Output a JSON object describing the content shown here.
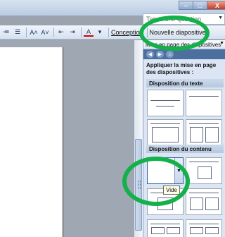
{
  "window": {
    "min": "–",
    "max": "□",
    "close": "X"
  },
  "help": {
    "placeholder": "Tapez une question"
  },
  "toolbar": {
    "items": [
      {
        "name": "bullets-icon",
        "glyph": "≔"
      },
      {
        "name": "numbering-icon",
        "glyph": "☰"
      },
      {
        "name": "font-grow-icon",
        "glyph": "A˄"
      },
      {
        "name": "font-shrink-icon",
        "glyph": "A˅"
      },
      {
        "name": "indent-less-icon",
        "glyph": "⇤"
      },
      {
        "name": "indent-more-icon",
        "glyph": "⇥"
      },
      {
        "name": "font-color-icon",
        "glyph": "A"
      },
      {
        "name": "dropdown-icon",
        "glyph": "▾"
      }
    ],
    "conception": "Conception",
    "nouvelle": "Nouvelle diapositive"
  },
  "pane": {
    "header": "Mise en page des diapositives",
    "nav": [
      "◀",
      "▶",
      "⌂"
    ],
    "title": "Appliquer la mise en page des diapositives :",
    "section_text": "Disposition du texte",
    "section_content": "Disposition du contenu",
    "tooltip": "Vide"
  }
}
